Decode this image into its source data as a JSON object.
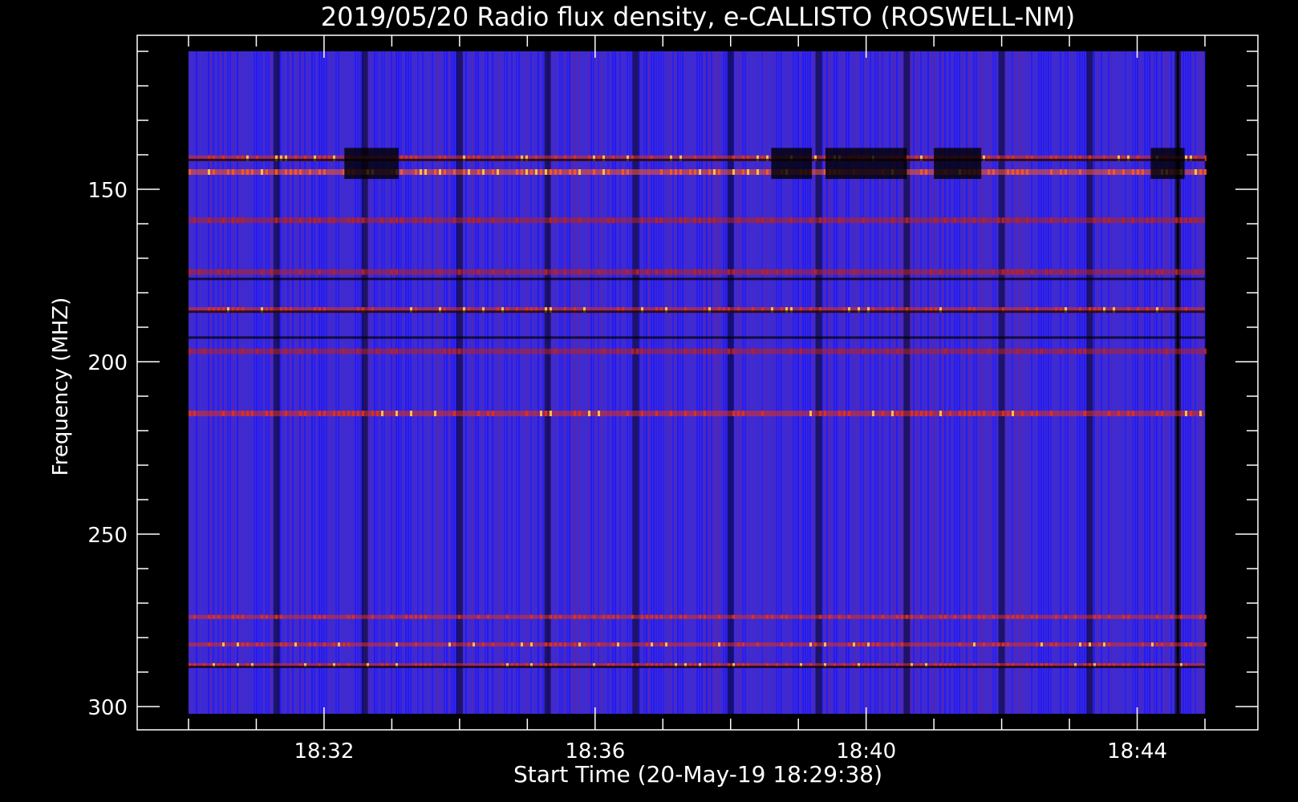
{
  "chart_data": {
    "type": "heatmap",
    "title": "2019/05/20  Radio flux density, e-CALLISTO (ROSWELL-NM)",
    "xlabel": "Start Time (20-May-19 18:29:38)",
    "ylabel": "Frequency (MHZ)",
    "x_ticks": [
      "18:32",
      "18:36",
      "18:40",
      "18:44"
    ],
    "y_ticks": [
      "150",
      "200",
      "250",
      "300"
    ],
    "x_tick_values_min": [
      32,
      36,
      40,
      44
    ],
    "y_tick_values": [
      150,
      200,
      250,
      300
    ],
    "xlim_min": [
      30.0,
      45.0
    ],
    "ylim": [
      110,
      302
    ],
    "y_inverted": true,
    "colormap": [
      "#000000",
      "#0000ff",
      "#5a20c8",
      "#c81e1e",
      "#ff6020",
      "#ffe040"
    ],
    "background_color": "#3a2bd8",
    "bright_bands_mhz": [
      {
        "freq": 141,
        "intensity": 0.85
      },
      {
        "freq": 145,
        "intensity": 0.95
      },
      {
        "freq": 159,
        "intensity": 0.55
      },
      {
        "freq": 174,
        "intensity": 0.55
      },
      {
        "freq": 185,
        "intensity": 0.75
      },
      {
        "freq": 197,
        "intensity": 0.45
      },
      {
        "freq": 215,
        "intensity": 0.8
      },
      {
        "freq": 274,
        "intensity": 0.7
      },
      {
        "freq": 282,
        "intensity": 0.75
      },
      {
        "freq": 288,
        "intensity": 0.8
      }
    ],
    "dark_bands_mhz": [
      141.5,
      176,
      185.5,
      193,
      288.5
    ],
    "dark_columns_min": [
      31.3,
      32.6,
      34.0,
      35.3,
      36.6,
      38.0,
      39.3,
      40.6,
      42.0,
      43.3,
      44.6
    ]
  }
}
